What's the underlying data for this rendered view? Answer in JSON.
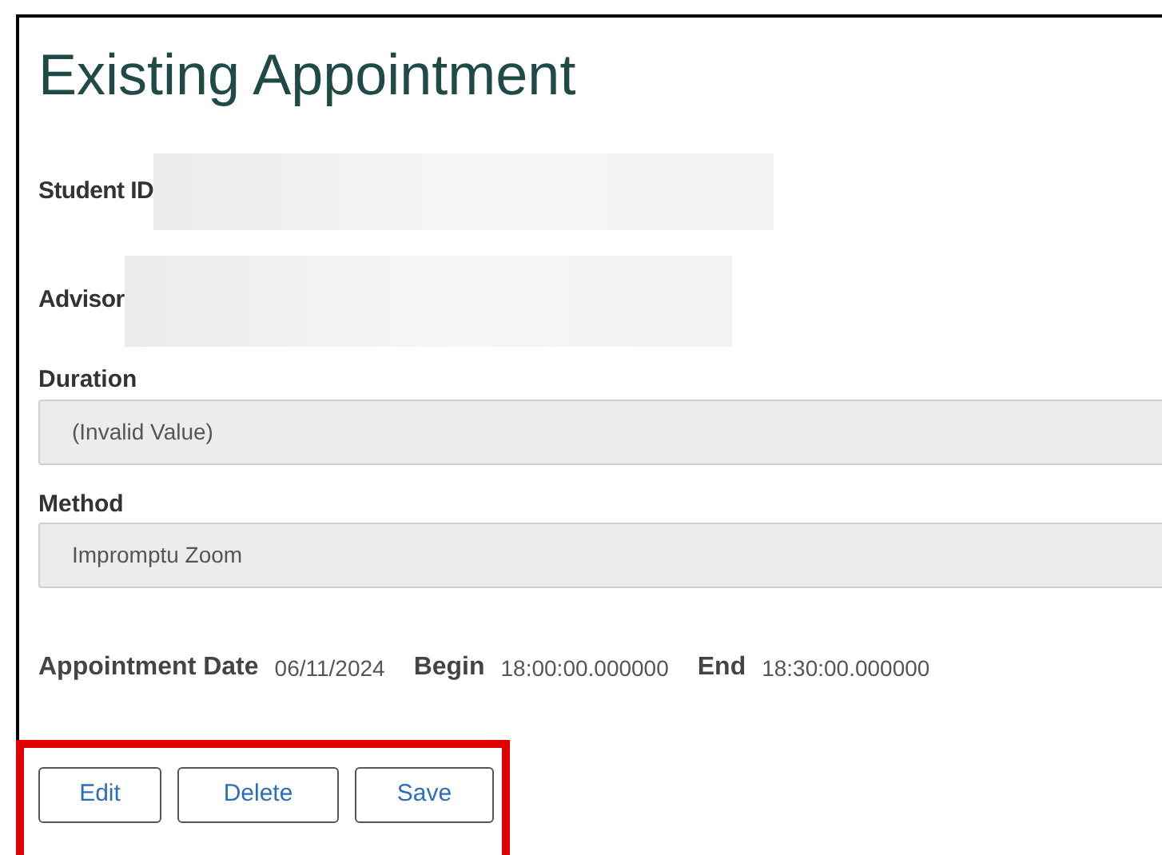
{
  "title": "Existing Appointment",
  "redacted_fields": [
    {
      "label": "Student ID"
    },
    {
      "label": "Advisor"
    }
  ],
  "selects": [
    {
      "label": "Duration",
      "value": "(Invalid Value)"
    },
    {
      "label": "Method",
      "value": "Impromptu Zoom"
    }
  ],
  "schedule": [
    {
      "label": "Appointment Date",
      "value": "06/11/2024"
    },
    {
      "label": "Begin",
      "value": "18:00:00.000000"
    },
    {
      "label": "End",
      "value": "18:30:00.000000"
    }
  ],
  "buttons": [
    "Edit",
    "Delete",
    "Save"
  ],
  "highlight": {
    "color": "#e00000"
  }
}
